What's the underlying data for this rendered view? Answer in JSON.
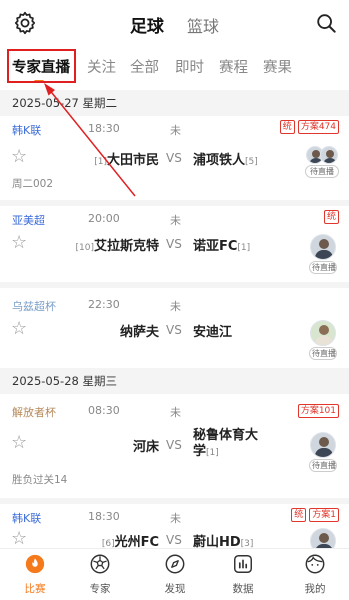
{
  "header": {
    "tabs": [
      "足球",
      "篮球"
    ],
    "active_tab": 0
  },
  "category_tabs": [
    "专家直播",
    "关注",
    "全部",
    "即时",
    "赛程",
    "赛果"
  ],
  "dates": [
    "2025-05-27 星期二",
    "2025-05-28 星期三"
  ],
  "matches": [
    {
      "league": "韩K联",
      "league_color": "#3a6bd8",
      "time": "18:30",
      "status": "未",
      "home": "大田市民",
      "home_rank": "[1]",
      "vs": "VS",
      "away": "浦项铁人",
      "away_rank": "[5]",
      "badges": [
        "统",
        "方案474"
      ],
      "extra": "周二002",
      "avatar_label": "待直播"
    },
    {
      "league": "亚美超",
      "league_color": "#3a6bd8",
      "time": "20:00",
      "status": "未",
      "home": "艾拉斯克特",
      "home_rank": "[10]",
      "vs": "VS",
      "away": "诺亚FC",
      "away_rank": "[1]",
      "badges": [
        "统"
      ],
      "extra": "",
      "avatar_label": "待直播"
    },
    {
      "league": "乌兹超杯",
      "league_color": "#7a9fc8",
      "time": "22:30",
      "status": "未",
      "home": "纳萨夫",
      "home_rank": "",
      "vs": "VS",
      "away": "安迪江",
      "away_rank": "",
      "badges": [],
      "extra": "",
      "avatar_label": "待直播"
    },
    {
      "league": "解放者杯",
      "league_color": "#b5895a",
      "time": "08:30",
      "status": "未",
      "home": "河床",
      "home_rank": "",
      "vs": "VS",
      "away": "秘鲁体育大学",
      "away_rank": "[1]",
      "badges": [
        "方案101"
      ],
      "extra": "胜负过关14",
      "avatar_label": "待直播"
    },
    {
      "league": "韩K联",
      "league_color": "#3a6bd8",
      "time": "18:30",
      "status": "未",
      "home": "光州FC",
      "home_rank": "[6]",
      "vs": "VS",
      "away": "蔚山HD",
      "away_rank": "[3]",
      "badges": [
        "统",
        "方案1"
      ],
      "extra": "",
      "avatar_label": ""
    }
  ],
  "bottom_nav": [
    "比赛",
    "专家",
    "发现",
    "数据",
    "我的"
  ],
  "colors": {
    "accent": "#f57a1c",
    "highlight": "#e02020",
    "badge": "#e0362c"
  }
}
